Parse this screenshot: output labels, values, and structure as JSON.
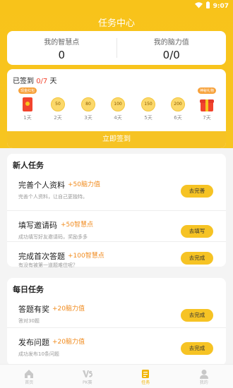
{
  "status_bar": {
    "time": "9:07"
  },
  "app_title": "任务中心",
  "stats": [
    {
      "label": "我的智慧点",
      "value": "0"
    },
    {
      "label": "我的脑力值",
      "value": "0/0"
    }
  ],
  "signin": {
    "title_prefix": "已签到 ",
    "progress": "0/7",
    "title_suffix": " 天",
    "days": [
      {
        "label": "1天",
        "coin": "",
        "badge": "现金红包",
        "icon": "red-envelope-icon"
      },
      {
        "label": "2天",
        "coin": "50"
      },
      {
        "label": "3天",
        "coin": "80"
      },
      {
        "label": "4天",
        "coin": "100"
      },
      {
        "label": "5天",
        "coin": "150"
      },
      {
        "label": "6天",
        "coin": "200"
      },
      {
        "label": "7天",
        "coin": "",
        "badge": "神秘礼物",
        "icon": "gift-icon"
      }
    ],
    "button": "立即签到"
  },
  "newbie": {
    "title": "新人任务",
    "tasks": [
      {
        "name": "完善个人资料",
        "reward": "+50脑力值",
        "desc": "完善个人资料，让自己更独特。",
        "button": "去完善"
      },
      {
        "name": "填写邀请码",
        "reward": "+50智慧点",
        "desc": "成功填写好友邀请码，奖励多多",
        "button": "去填写"
      },
      {
        "name": "完成首次答题",
        "reward": "+100智慧点",
        "desc": "有没有被第一道题难住呢？",
        "button": "去完成"
      }
    ]
  },
  "daily": {
    "title": "每日任务",
    "tasks": [
      {
        "name": "答题有奖",
        "reward": "+20脑力值",
        "desc": "答对30题",
        "button": "去完成"
      },
      {
        "name": "发布问题",
        "reward": "+20脑力值",
        "desc": "成功发布10条问题",
        "button": "去完成"
      }
    ]
  },
  "tabbar": [
    {
      "label": "首页",
      "icon": "home-icon"
    },
    {
      "label": "PK赛",
      "icon": "vs-icon"
    },
    {
      "label": "任务",
      "icon": "task-icon",
      "active": true
    },
    {
      "label": "我的",
      "icon": "profile-icon"
    }
  ],
  "colors": {
    "accent": "#f7c520",
    "reward": "#f08a1c",
    "highlight": "#f2442d"
  }
}
